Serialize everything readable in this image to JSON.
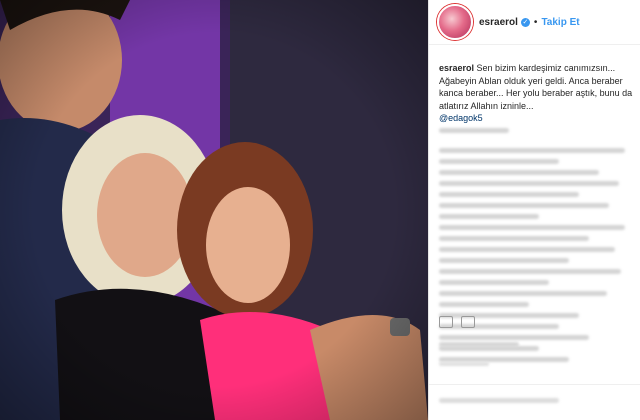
{
  "post": {
    "username": "esraerol",
    "separator": "•",
    "follow_label": "Takip Et",
    "caption_user": "esraerol",
    "caption_text": "Sen bizim kardeşimiz canımızsın... Ağabeyin Ablan olduk yeri geldi. Anca beraber kanca beraber... Her yolu beraber aştık, bunu da atlatırız Allahın izninle...",
    "mention": "@edagok5"
  },
  "icons": {
    "verified": "verified-badge-icon",
    "like": "heart-icon",
    "comment": "comment-icon",
    "share": "share-icon"
  },
  "colors": {
    "link": "#3897f0",
    "text": "#262626",
    "mention": "#003569"
  }
}
